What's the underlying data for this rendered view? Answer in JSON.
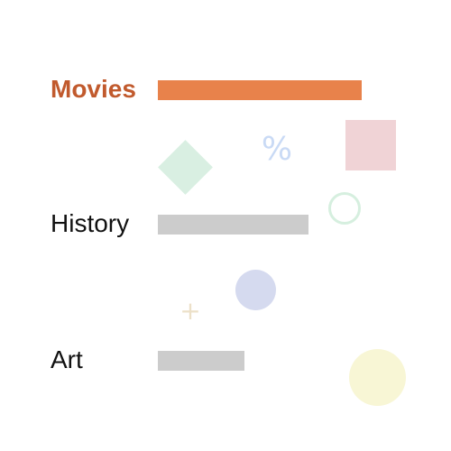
{
  "decorations": {
    "percent_symbol": "%",
    "plus_symbol": "+"
  },
  "categories": [
    {
      "label": "Movies",
      "selected": true,
      "level": 1.0
    },
    {
      "label": "History",
      "selected": false,
      "level": 0.74
    },
    {
      "label": "Art",
      "selected": false,
      "level": 0.42
    }
  ],
  "colors": {
    "selected_label": "#c15a2d",
    "selected_bar": "#e8824b",
    "inactive_bar": "#cccccc",
    "text": "#111111"
  }
}
